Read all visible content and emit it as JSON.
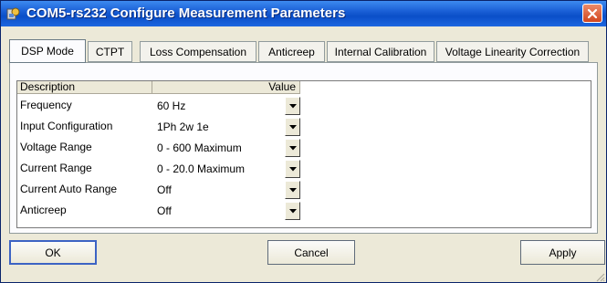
{
  "window": {
    "title": "COM5-rs232 Configure Measurement Parameters",
    "accent_color": "#1a5fd6",
    "icon": "app-icon",
    "close_icon": "close-icon"
  },
  "tabs": [
    {
      "label": "DSP Mode",
      "active": true
    },
    {
      "label": "CTPT",
      "active": false
    },
    {
      "label": "Loss Compensation",
      "active": false
    },
    {
      "label": "Anticreep",
      "active": false
    },
    {
      "label": "Internal Calibration",
      "active": false
    },
    {
      "label": "Voltage Linearity Correction",
      "active": false
    }
  ],
  "grid": {
    "columns": [
      "Description",
      "Value"
    ],
    "rows": [
      {
        "label": "Frequency",
        "value": "60 Hz"
      },
      {
        "label": "Input Configuration",
        "value": "1Ph 2w 1e"
      },
      {
        "label": "Voltage Range",
        "value": "0 - 600 Maximum"
      },
      {
        "label": "Current Range",
        "value": "0 - 20.0 Maximum"
      },
      {
        "label": "Current Auto Range",
        "value": "Off"
      },
      {
        "label": "Anticreep",
        "value": "Off"
      }
    ],
    "dropdown_icon": "chevron-down-icon"
  },
  "buttons": {
    "ok": "OK",
    "cancel": "Cancel",
    "apply": "Apply"
  }
}
